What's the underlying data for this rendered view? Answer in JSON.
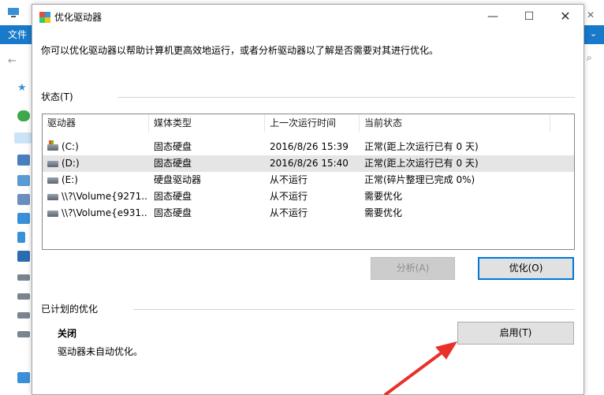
{
  "background": {
    "file_tab": "文件"
  },
  "window": {
    "title": "优化驱动器",
    "minimize": "—",
    "maximize": "☐",
    "close": "✕"
  },
  "description": "你可以优化驱动器以帮助计算机更高效地运行，或者分析驱动器以了解是否需要对其进行优化。",
  "status": {
    "label": "状态(T)",
    "columns": [
      "驱动器",
      "媒体类型",
      "上一次运行时间",
      "当前状态"
    ],
    "rows": [
      {
        "drive": "(C:)",
        "media": "固态硬盘",
        "last_run": "2016/8/26 15:39",
        "state": "正常(距上次运行已有 0 天)",
        "selected": false
      },
      {
        "drive": "(D:)",
        "media": "固态硬盘",
        "last_run": "2016/8/26 15:40",
        "state": "正常(距上次运行已有 0 天)",
        "selected": true
      },
      {
        "drive": "(E:)",
        "media": "硬盘驱动器",
        "last_run": "从不运行",
        "state": "正常(碎片整理已完成 0%)",
        "selected": false
      },
      {
        "drive": "\\\\?\\Volume{9271...",
        "media": "固态硬盘",
        "last_run": "从不运行",
        "state": "需要优化",
        "selected": false
      },
      {
        "drive": "\\\\?\\Volume{e931...",
        "media": "固态硬盘",
        "last_run": "从不运行",
        "state": "需要优化",
        "selected": false
      }
    ]
  },
  "buttons": {
    "analyze": "分析(A)",
    "optimize": "优化(O)",
    "enable": "启用(T)"
  },
  "scheduled": {
    "label": "已计划的优化",
    "state": "关闭",
    "description": "驱动器未自动优化。"
  },
  "colors": {
    "accent": "#0078d7",
    "ribbon": "#1979ca",
    "arrow": "#e8312a"
  }
}
